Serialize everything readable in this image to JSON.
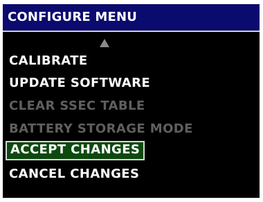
{
  "window": {
    "title": "CONFIGURE MENU"
  },
  "colors": {
    "title_background": "#0b0a6e",
    "screen_background": "#000000",
    "enabled_text": "#ffffff",
    "disabled_text": "#5f5f5f",
    "selected_background": "#0d4a0f"
  },
  "scroll": {
    "up_indicator_icon": "triangle-up-icon"
  },
  "menu": {
    "items": [
      {
        "label": "CALIBRATE",
        "state": "enabled"
      },
      {
        "label": "UPDATE SOFTWARE",
        "state": "enabled"
      },
      {
        "label": "CLEAR SSEC TABLE",
        "state": "disabled"
      },
      {
        "label": "BATTERY STORAGE MODE",
        "state": "disabled"
      },
      {
        "label": "ACCEPT CHANGES",
        "state": "selected"
      },
      {
        "label": "CANCEL CHANGES",
        "state": "enabled"
      }
    ]
  }
}
